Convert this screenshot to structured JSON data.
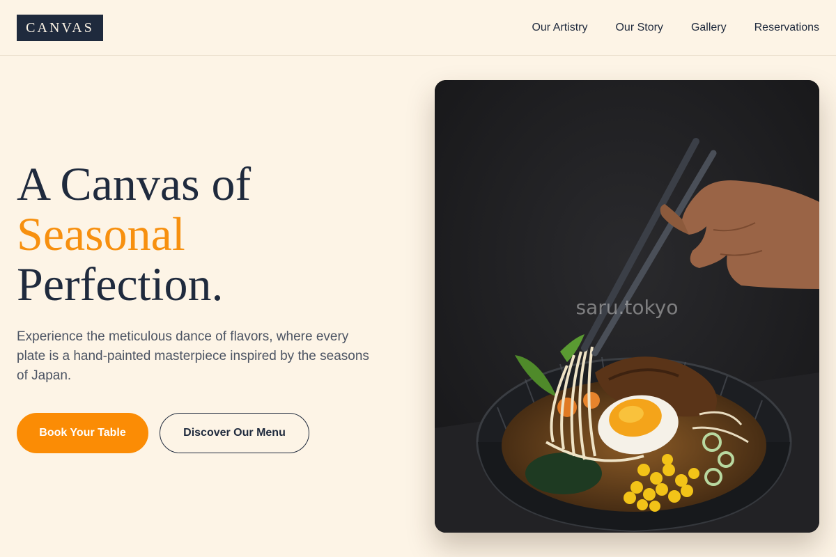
{
  "header": {
    "logo": "CANVAS",
    "nav": [
      "Our Artistry",
      "Our Story",
      "Gallery",
      "Reservations"
    ]
  },
  "hero": {
    "title_line1": "A Canvas of",
    "title_line2": "Seasonal",
    "title_line3": "Perfection.",
    "subtitle": "Experience the meticulous dance of flavors, where every plate is a hand-painted masterpiece inspired by the seasons of Japan.",
    "primary_button": "Book Your Table",
    "secondary_button": "Discover Our Menu"
  },
  "image": {
    "watermark": "saru.tokyo"
  },
  "colors": {
    "background": "#fdf4e6",
    "navy": "#1f2a3d",
    "accent": "#f7900f",
    "button": "#fb8c05"
  }
}
